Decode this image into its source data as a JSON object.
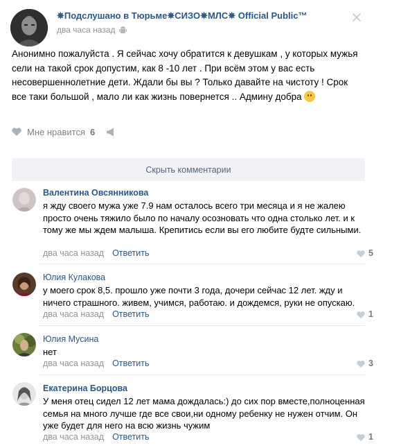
{
  "post": {
    "title": "✵Подслушано в Тюрьме✵СИЗО✵МЛС✵ Official Public™",
    "time": "два часа назад",
    "text": "Анонимно пожалуйста . Я сейчас хочу обратится к девушкам , у которых мужья сели на такой срок допустим, как 8 -10 лет . При всём этом у вас есть несовершеннолетние дети. Ждали бы вы ? Только давайте на чистоту ! Срок все таки большой , мало ли как жизнь повернется .. Админу добра",
    "like_label": "Мне нравится",
    "like_count": "6"
  },
  "comments_bar": {
    "hide_label": "Скрыть комментарии"
  },
  "comments": [
    {
      "author": "Валентина Овсянникова",
      "text": "я жду своего мужа уже 7.9 нам осталось всего три месяца и я не жалею просто очень тяжило было по началу осозновать что одна столько лет. и к тому же мы ждем малыша. Крепитись если вы его любите будте сильными.",
      "time": "два часа назад",
      "reply": "Ответить",
      "likes": "5"
    },
    {
      "author": "Юлия Кулакова",
      "text": "у моего срок 8,5. прошло уже почти 3 года, дочери сейчас 12 лет. жду и ничего страшного. живем, учимся, работаю. и дождемся, руки не опускаю.",
      "time": "два часа назад",
      "reply": "Ответить",
      "likes": "1"
    },
    {
      "author": "Юлия Мусина",
      "text": "нет",
      "time": "два часа назад",
      "reply": "Ответить",
      "likes": "3"
    },
    {
      "author": "Екатерина Борцова",
      "text": "У меня отец сидел 12 лет мама дождалась:) до сих пор вместе,полноценная семья на много лучше где все свои,ни одному ребенку не нужен отчим. Он уже будет для него на всю жизнь чужим",
      "time": "два часа назад",
      "reply": "Ответить",
      "likes": "1"
    }
  ],
  "colors": {
    "link": "#2a5885",
    "meta": "#939393",
    "bar": "#f0f2f5"
  }
}
